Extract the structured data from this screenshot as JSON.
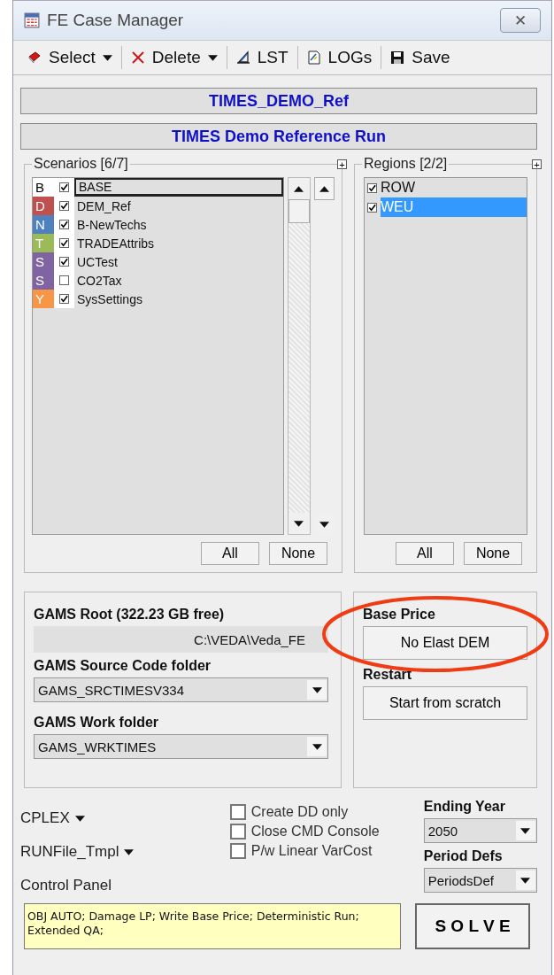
{
  "window": {
    "title": "FE Case Manager",
    "close": "✕"
  },
  "toolbar": [
    {
      "kind": "book",
      "label": "Select",
      "menu": true
    },
    {
      "kind": "cross",
      "label": "Delete",
      "menu": true
    },
    {
      "kind": "pencil",
      "label": "LST",
      "menu": false
    },
    {
      "kind": "log",
      "label": "LOGs",
      "menu": false
    },
    {
      "kind": "disk",
      "label": "Save",
      "menu": false
    }
  ],
  "case_name": "TIMES_DEMO_Ref",
  "case_description": "TIMES Demo Reference Run",
  "scenarios": {
    "title": "Scenarios [6/7]",
    "expand": "+",
    "items": [
      {
        "letter": "B",
        "color": "#ffffff",
        "checked": true,
        "name": "BASE",
        "selected": true
      },
      {
        "letter": "D",
        "color": "#c0504d",
        "checked": true,
        "name": "DEM_Ref",
        "selected": false
      },
      {
        "letter": "N",
        "color": "#4f81bd",
        "checked": true,
        "name": "B-NewTechs",
        "selected": false
      },
      {
        "letter": "T",
        "color": "#9bbb59",
        "checked": true,
        "name": "TRADEAttribs",
        "selected": false
      },
      {
        "letter": "S",
        "color": "#8064a2",
        "checked": true,
        "name": "UCTest",
        "selected": false
      },
      {
        "letter": "S",
        "color": "#8064a2",
        "checked": false,
        "name": "CO2Tax",
        "selected": false
      },
      {
        "letter": "Y",
        "color": "#f79646",
        "checked": true,
        "name": "SysSettings",
        "selected": false
      }
    ],
    "buttons": [
      "All",
      "None"
    ]
  },
  "regions": {
    "title": "Regions [2/2]",
    "expand": "+",
    "items": [
      {
        "checked": true,
        "name": "ROW",
        "selected": false
      },
      {
        "checked": true,
        "name": "WEU",
        "selected": true
      }
    ],
    "buttons": [
      "All",
      "None"
    ]
  },
  "gams": {
    "root_label": "GAMS Root (322.23 GB free)",
    "root_value": "C:\\VEDA\\Veda_FE",
    "source_label": "GAMS Source Code folder",
    "source_value": "GAMS_SRCTIMESV334",
    "work_label": "GAMS Work folder",
    "work_value": "GAMS_WRKTIMES"
  },
  "base_price": {
    "label": "Base Price",
    "value": "No Elast DEM",
    "highlighted": true
  },
  "restart": {
    "label": "Restart",
    "value": "Start from scratch"
  },
  "menus": [
    "CPLEX",
    "RUNFile_Tmpl"
  ],
  "control_panel": "Control Panel",
  "options": [
    {
      "label": "Create DD only",
      "checked": false
    },
    {
      "label": "Close CMD Console",
      "checked": false
    },
    {
      "label": "P/w Linear VarCost",
      "checked": false
    }
  ],
  "ending_year": {
    "label": "Ending Year",
    "value": "2050"
  },
  "period_defs": {
    "label": "Period Defs",
    "value": "PeriodsDef"
  },
  "run_summary": "OBJ AUTO; Damage LP; Write Base Price; Deterministic Run; Extended QA;",
  "solve": "S O L V E"
}
